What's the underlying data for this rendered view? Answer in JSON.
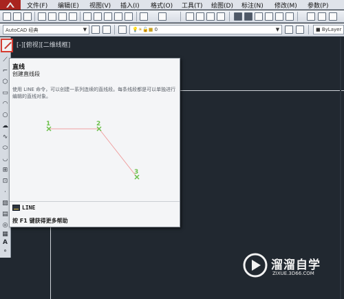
{
  "menubar": {
    "items": [
      {
        "label": "文件(F)"
      },
      {
        "label": "编辑(E)"
      },
      {
        "label": "视图(V)"
      },
      {
        "label": "插入(I)"
      },
      {
        "label": "格式(O)"
      },
      {
        "label": "工具(T)"
      },
      {
        "label": "绘图(D)"
      },
      {
        "label": "标注(N)"
      },
      {
        "label": "修改(M)"
      },
      {
        "label": "参数(P)"
      }
    ]
  },
  "toolbar": {
    "workspace_value": "AutoCAD 经典",
    "layer_value": "0",
    "linetype_value": "ByLayer"
  },
  "viewport": {
    "label": "[-][俯视][二维线框]"
  },
  "tooltip": {
    "title": "直线",
    "subtitle": "创建直线段",
    "description": "使用 LINE 命令，可以创建一系列连续的直线段。每条线段都是可以单独进行编辑的直线对象。",
    "figure_points": [
      "1",
      "2",
      "3"
    ],
    "command": "LINE",
    "help": "按 F1 键获得更多帮助"
  },
  "watermark": {
    "name": "溜溜自学",
    "url": "ZIXUE.3D66.COM"
  },
  "colors": {
    "canvas_bg": "#212830",
    "accent_red": "#d63a2f",
    "figure_point": "#6cc04a",
    "figure_line": "#f0a0a0"
  }
}
